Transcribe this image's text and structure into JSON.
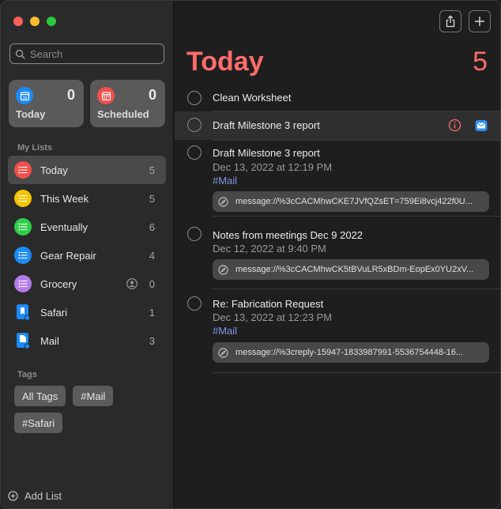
{
  "sidebar": {
    "search_placeholder": "Search",
    "smart_lists": [
      {
        "label": "Today",
        "count": "0",
        "icon": "calendar-today-icon",
        "color": "#1c8bf5"
      },
      {
        "label": "Scheduled",
        "count": "0",
        "icon": "calendar-scheduled-icon",
        "color": "#f0504c"
      }
    ],
    "my_lists_header": "My Lists",
    "lists": [
      {
        "name": "Today",
        "count": "5",
        "color": "#f0504c",
        "selected": true
      },
      {
        "name": "This Week",
        "count": "5",
        "color": "#f5c400"
      },
      {
        "name": "Eventually",
        "count": "6",
        "color": "#2fcf4b"
      },
      {
        "name": "Gear Repair",
        "count": "4",
        "color": "#1c8bf5"
      },
      {
        "name": "Grocery",
        "count": "0",
        "color": "#b47be8",
        "shared": true
      },
      {
        "name": "Safari",
        "count": "1",
        "icon": "safari-list-icon"
      },
      {
        "name": "Mail",
        "count": "3",
        "icon": "mail-list-icon"
      }
    ],
    "tags_header": "Tags",
    "tags": [
      "All Tags",
      "#Mail",
      "#Safari"
    ],
    "add_list": "Add List"
  },
  "main": {
    "title": "Today",
    "count": "5",
    "accent": "#ff6b6b",
    "tasks": [
      {
        "title": "Clean Worksheet"
      },
      {
        "title": "Draft Milestone 3 report"
      },
      {
        "title": "Draft Milestone 3 report",
        "date": "Dec 13, 2022 at 12:19 PM",
        "tag": "#Mail",
        "link": "message://%3cCACMhwCKE7JVfQZsET=759Ei8vcj422f0U..."
      },
      {
        "title": "Notes from meetings Dec 9 2022",
        "date": "Dec 12, 2022 at 9:40 PM",
        "link": "message://%3cCACMhwCK5tBVuLR5xBDm-EopEx0YU2xV..."
      },
      {
        "title": "Re: Fabrication Request",
        "date": "Dec 13, 2022 at 12:23 PM",
        "tag": "#Mail",
        "link": "message://%3creply-15947-1833987991-5536754448-16..."
      }
    ]
  }
}
